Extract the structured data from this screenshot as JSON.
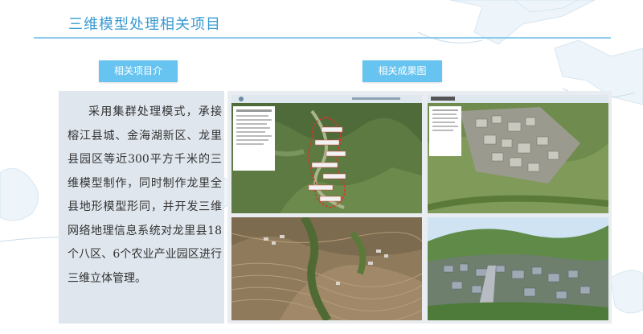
{
  "header": {
    "title": "三维模型处理相关项目"
  },
  "buttons": {
    "intro": "相关项目介",
    "results": "相关成果图"
  },
  "description": "采用集群处理模式，承接榕江县城、金海湖新区、龙里县园区等近300平方千米的三维模型制作，同时制作龙里全县地形模型形同，并开发三维网络地理信息系统对龙里县18个八区、6个农业产业园区进行三维立体管理。",
  "gallery": {
    "images": [
      {
        "name": "map-overview-screenshot"
      },
      {
        "name": "village-3d-model-screenshot"
      },
      {
        "name": "terraced-hills-aerial-photo"
      },
      {
        "name": "town-3d-terrain-model"
      }
    ]
  },
  "colors": {
    "accent": "#3a9bd3",
    "rule": "#8ccbf0",
    "button": "#67c4f0",
    "panel": "#dfe6ed"
  }
}
